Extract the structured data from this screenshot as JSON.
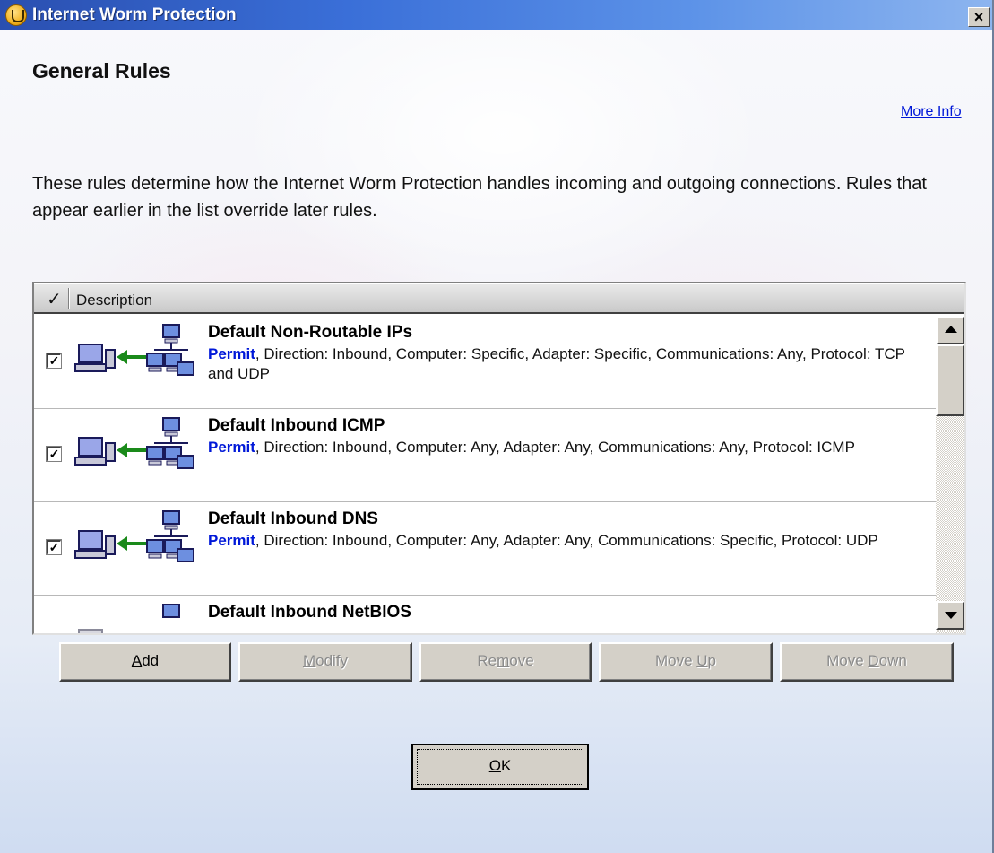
{
  "window": {
    "title": "Internet Worm Protection",
    "close_glyph": "×"
  },
  "page": {
    "title": "General Rules",
    "more_info": "More Info",
    "intro": "These rules determine how the Internet Worm Protection handles incoming and outgoing connections. Rules that appear earlier in the list override later rules."
  },
  "list": {
    "header_check": "✓",
    "header_description": "Description",
    "rows": [
      {
        "checked": "✓",
        "name": "Default Non-Routable IPs",
        "action": "Permit",
        "detail": ", Direction: Inbound, Computer: Specific, Adapter: Specific, Communications: Any, Protocol: TCP and UDP"
      },
      {
        "checked": "✓",
        "name": "Default Inbound ICMP",
        "action": "Permit",
        "detail": ", Direction: Inbound, Computer: Any, Adapter: Any, Communications: Any, Protocol: ICMP"
      },
      {
        "checked": "✓",
        "name": "Default Inbound DNS",
        "action": "Permit",
        "detail": ", Direction: Inbound, Computer: Any, Adapter: Any, Communications: Specific, Protocol: UDP"
      },
      {
        "checked": "",
        "name": "Default Inbound NetBIOS",
        "action": "",
        "detail": ""
      }
    ]
  },
  "buttons": {
    "add_key": "A",
    "add_rest": "dd",
    "modify_key": "M",
    "modify_rest": "odify",
    "remove_pre": "Re",
    "remove_key": "m",
    "remove_rest": "ove",
    "moveup_pre": "Move ",
    "moveup_key": "U",
    "moveup_rest": "p",
    "movedown_pre": "Move ",
    "movedown_key": "D",
    "movedown_rest": "own",
    "ok_key": "O",
    "ok_rest": "K"
  },
  "colors": {
    "title_bar": "#3a6fd8",
    "link": "#0018d8",
    "action": "#0018d8",
    "arrow": "#1a8a1a"
  },
  "icons": {
    "app": "shield-logo-icon",
    "rule": "network-inbound-icon"
  }
}
